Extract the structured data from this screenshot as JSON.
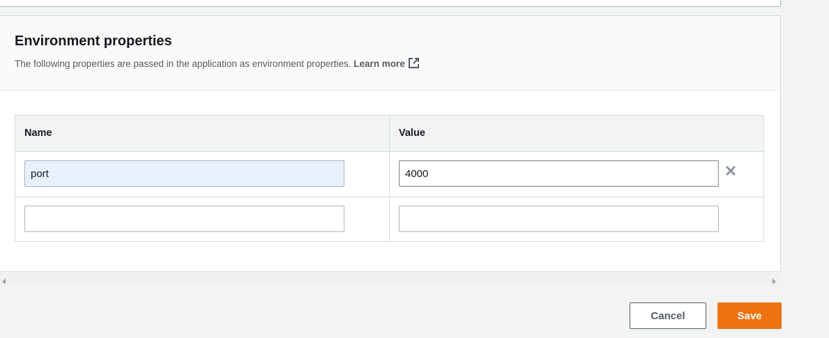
{
  "section": {
    "title": "Environment properties",
    "description": "The following properties are passed in the application as environment properties.",
    "learn_more": "Learn more",
    "learn_more_icon": "external-link-icon"
  },
  "table": {
    "headers": {
      "name": "Name",
      "value": "Value"
    },
    "rows": [
      {
        "name": "port",
        "value": "4000",
        "removable": true
      },
      {
        "name": "",
        "value": "",
        "removable": false
      }
    ],
    "remove_icon": "close-icon"
  },
  "footer": {
    "cancel_label": "Cancel",
    "save_label": "Save"
  },
  "colors": {
    "accent": "#ec7211",
    "autofill": "#e8f0fe",
    "text": "#16191f",
    "secondary_text": "#545b64"
  }
}
